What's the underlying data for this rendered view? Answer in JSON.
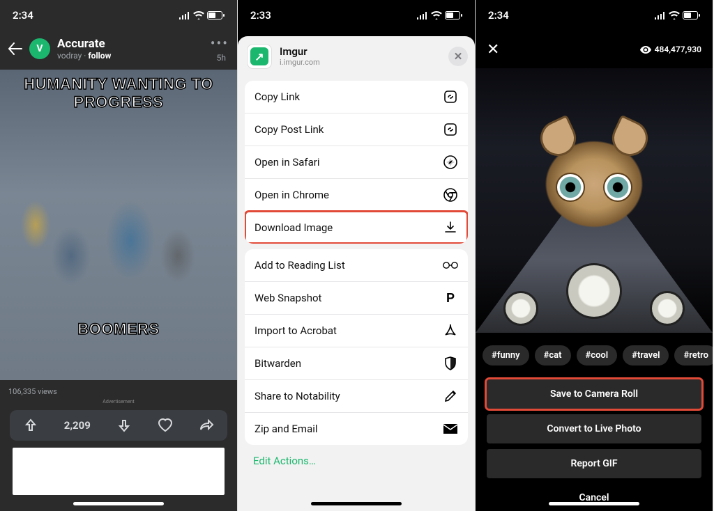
{
  "phone1": {
    "status_time": "2:34",
    "header": {
      "title": "Accurate",
      "username": "vodray",
      "follow_label": "follow",
      "time": "5h",
      "avatar_letter": "V"
    },
    "meme": {
      "top_text": "HUMANITY WANTING TO PROGRESS",
      "bottom_text": "BOOMERS"
    },
    "views_label": "106,335 views",
    "ad_label": "Advertisement",
    "vote_count": "2,209"
  },
  "phone2": {
    "status_time": "2:33",
    "app_name": "Imgur",
    "app_domain": "i.imgur.com",
    "actions_group1": [
      {
        "label": "Copy Link",
        "icon": "link"
      },
      {
        "label": "Copy Post Link",
        "icon": "link"
      },
      {
        "label": "Open in Safari",
        "icon": "compass"
      },
      {
        "label": "Open in Chrome",
        "icon": "chrome"
      },
      {
        "label": "Download Image",
        "icon": "download",
        "highlight": true
      }
    ],
    "actions_group2": [
      {
        "label": "Add to Reading List",
        "icon": "glasses"
      },
      {
        "label": "Web Snapshot",
        "icon": "p"
      },
      {
        "label": "Import to Acrobat",
        "icon": "acrobat"
      },
      {
        "label": "Bitwarden",
        "icon": "shield"
      },
      {
        "label": "Share to Notability",
        "icon": "pencil"
      },
      {
        "label": "Zip and Email",
        "icon": "mail"
      }
    ],
    "edit_label": "Edit Actions…"
  },
  "phone3": {
    "status_time": "2:34",
    "view_count": "484,477,930",
    "tags": [
      "#funny",
      "#cat",
      "#cool",
      "#travel",
      "#retro"
    ],
    "buttons": {
      "save": "Save to Camera Roll",
      "convert": "Convert to Live Photo",
      "report": "Report GIF",
      "cancel": "Cancel"
    }
  }
}
